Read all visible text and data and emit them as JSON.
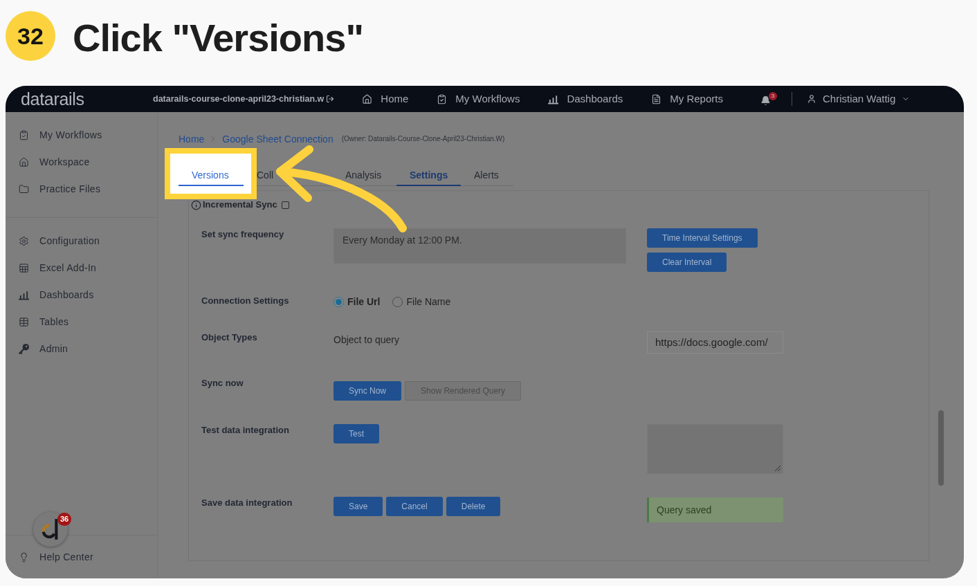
{
  "step": {
    "number": "32",
    "title": "Click \"Versions\""
  },
  "topbar": {
    "logo": "datarails",
    "workspace": "datarails-course-clone-april23-christian.w",
    "nav": [
      "Home",
      "My Workflows",
      "Dashboards",
      "My Reports"
    ],
    "notification_count": "3",
    "user": "Christian Wattig"
  },
  "sidebar": {
    "sections": [
      [
        "My Workflows",
        "Workspace",
        "Practice Files"
      ],
      [
        "Configuration",
        "Excel Add-In",
        "Dashboards",
        "Tables",
        "Admin"
      ]
    ],
    "footer": "Help Center",
    "widget_badge": "36"
  },
  "breadcrumb": {
    "items": [
      "Home",
      "Google Sheet Connection"
    ],
    "owner": "(Owner: Datarails-Course-Clone-April23-Christian.W)"
  },
  "tabs": [
    {
      "label": "Versions",
      "selected": false,
      "highlighted": true
    },
    {
      "label": "Coll",
      "selected": false,
      "highlighted": false
    },
    {
      "label": "Analysis",
      "selected": false,
      "highlighted": false
    },
    {
      "label": "Settings",
      "selected": true,
      "highlighted": false
    },
    {
      "label": "Alerts",
      "selected": false,
      "highlighted": false
    }
  ],
  "incremental_sync": {
    "label": "Incremental Sync",
    "checked": false
  },
  "rows": [
    {
      "kind": "schedule",
      "label": "Set sync frequency",
      "value": "Every Monday at 12:00 PM.",
      "buttons": [
        {
          "label": "Time Interval Settings",
          "kind": "primary"
        },
        {
          "label": "Clear Interval",
          "kind": "primary"
        }
      ]
    },
    {
      "kind": "choice",
      "label": "Connection Settings",
      "options": [
        {
          "label": "File Url",
          "selected": true
        },
        {
          "label": "File Name",
          "selected": false
        }
      ]
    },
    {
      "kind": "object",
      "label": "Object Types",
      "text": "Object to query",
      "value": "https://docs.google.com/"
    },
    {
      "kind": "actions",
      "label": "Sync now",
      "buttons": [
        {
          "label": "Sync Now",
          "kind": "primary"
        },
        {
          "label": "Show Rendered Query",
          "kind": "secondary"
        }
      ]
    },
    {
      "kind": "actions",
      "label": "Test data integration",
      "buttons": [
        {
          "label": "Test",
          "kind": "primary"
        }
      ],
      "side": {
        "kind": "output"
      }
    },
    {
      "kind": "actions",
      "label": "Save data integration",
      "buttons": [
        {
          "label": "Save",
          "kind": "primary"
        },
        {
          "label": "Cancel",
          "kind": "primary"
        },
        {
          "label": "Delete",
          "kind": "primary"
        }
      ],
      "side": {
        "kind": "message",
        "text": "Query saved"
      }
    }
  ]
}
